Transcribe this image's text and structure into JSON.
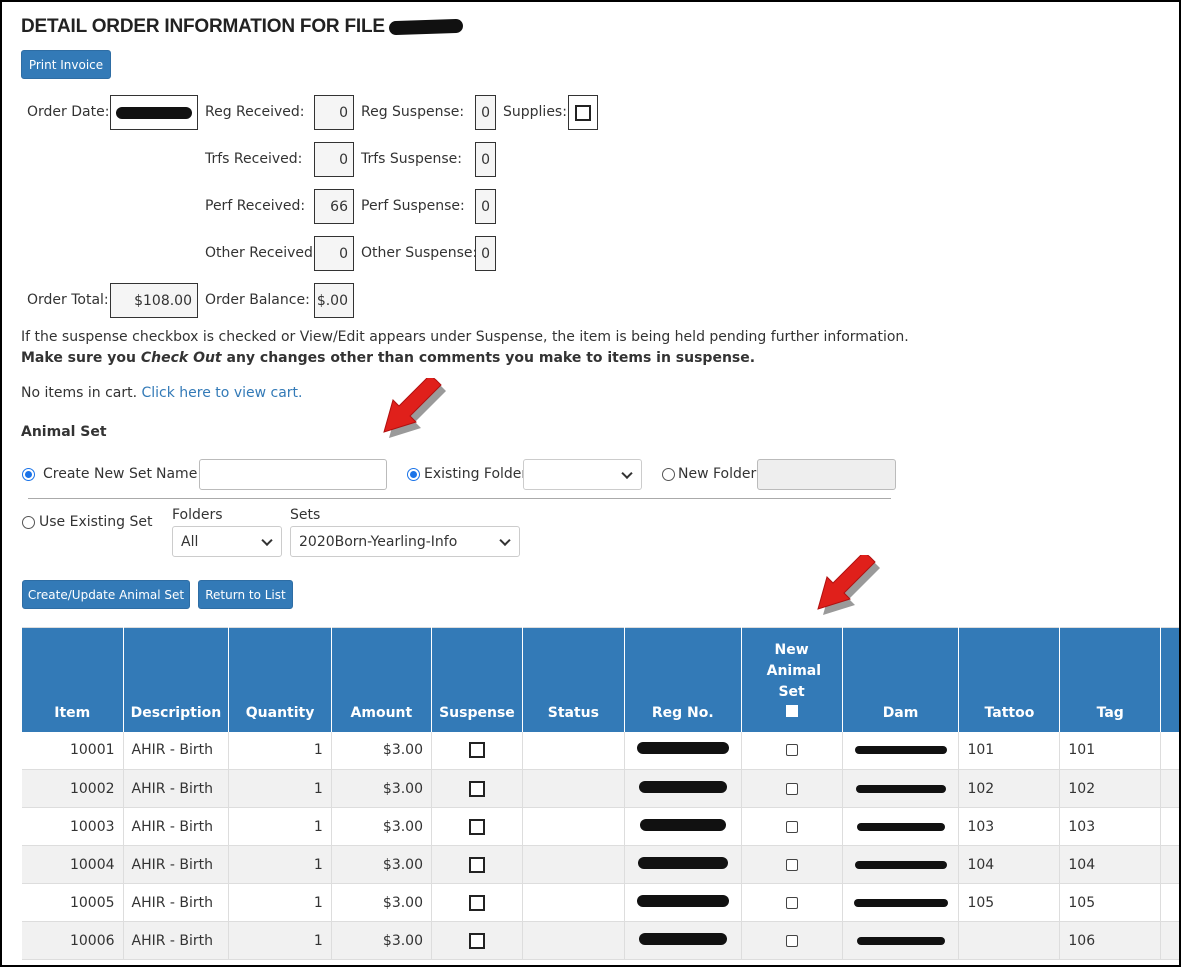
{
  "page": {
    "title": "DETAIL ORDER INFORMATION FOR FILE",
    "print_button": "Print Invoice"
  },
  "order": {
    "order_date_label": "Order Date:",
    "reg_received_label": "Reg Received:",
    "reg_received": "0",
    "reg_suspense_label": "Reg Suspense:",
    "reg_suspense": "0",
    "supplies_label": "Supplies:",
    "trfs_received_label": "Trfs Received:",
    "trfs_received": "0",
    "trfs_suspense_label": "Trfs Suspense:",
    "trfs_suspense": "0",
    "perf_received_label": "Perf Received:",
    "perf_received": "66",
    "perf_suspense_label": "Perf Suspense:",
    "perf_suspense": "0",
    "other_received_label": "Other Received:",
    "other_received": "0",
    "other_suspense_label": "Other Suspense:",
    "other_suspense": "0",
    "order_total_label": "Order Total:",
    "order_total": "$108.00",
    "order_balance_label": "Order Balance:",
    "order_balance": "$.00"
  },
  "info": {
    "line1": "If the suspense checkbox is checked or View/Edit appears under Suspense, the item is being held pending further information.",
    "line2_pre": "Make sure you ",
    "line2_em": "Check Out",
    "line2_post": " any changes other than comments you make to items in suspense."
  },
  "cart": {
    "text": "No items in cart.",
    "link": "Click here to view cart."
  },
  "animal_set": {
    "heading": "Animal Set",
    "create_new_label": "Create New Set",
    "name_label": "Name",
    "existing_folder_label": "Existing Folder",
    "new_folder_label": "New Folder",
    "use_existing_label": "Use Existing Set",
    "folders_label": "Folders",
    "folders_value": "All",
    "sets_label": "Sets",
    "sets_value": "2020Born-Yearling-Info",
    "create_update_button": "Create/Update Animal Set",
    "return_button": "Return to List"
  },
  "table": {
    "headers": {
      "item": "Item",
      "description": "Description",
      "quantity": "Quantity",
      "amount": "Amount",
      "suspense": "Suspense",
      "status": "Status",
      "reg_no": "Reg No.",
      "new_animal_set": "New Animal Set",
      "dam": "Dam",
      "tattoo": "Tattoo",
      "tag": "Tag"
    },
    "rows": [
      {
        "item": "10001",
        "description": "AHIR - Birth",
        "quantity": "1",
        "amount": "$3.00",
        "tattoo": "101",
        "tag": "101"
      },
      {
        "item": "10002",
        "description": "AHIR - Birth",
        "quantity": "1",
        "amount": "$3.00",
        "tattoo": "102",
        "tag": "102"
      },
      {
        "item": "10003",
        "description": "AHIR - Birth",
        "quantity": "1",
        "amount": "$3.00",
        "tattoo": "103",
        "tag": "103"
      },
      {
        "item": "10004",
        "description": "AHIR - Birth",
        "quantity": "1",
        "amount": "$3.00",
        "tattoo": "104",
        "tag": "104"
      },
      {
        "item": "10005",
        "description": "AHIR - Birth",
        "quantity": "1",
        "amount": "$3.00",
        "tattoo": "105",
        "tag": "105"
      },
      {
        "item": "10006",
        "description": "AHIR - Birth",
        "quantity": "1",
        "amount": "$3.00",
        "tattoo": "",
        "tag": "106"
      }
    ]
  },
  "colors": {
    "primary": "#337ab7",
    "arrow": "#e0201b"
  }
}
